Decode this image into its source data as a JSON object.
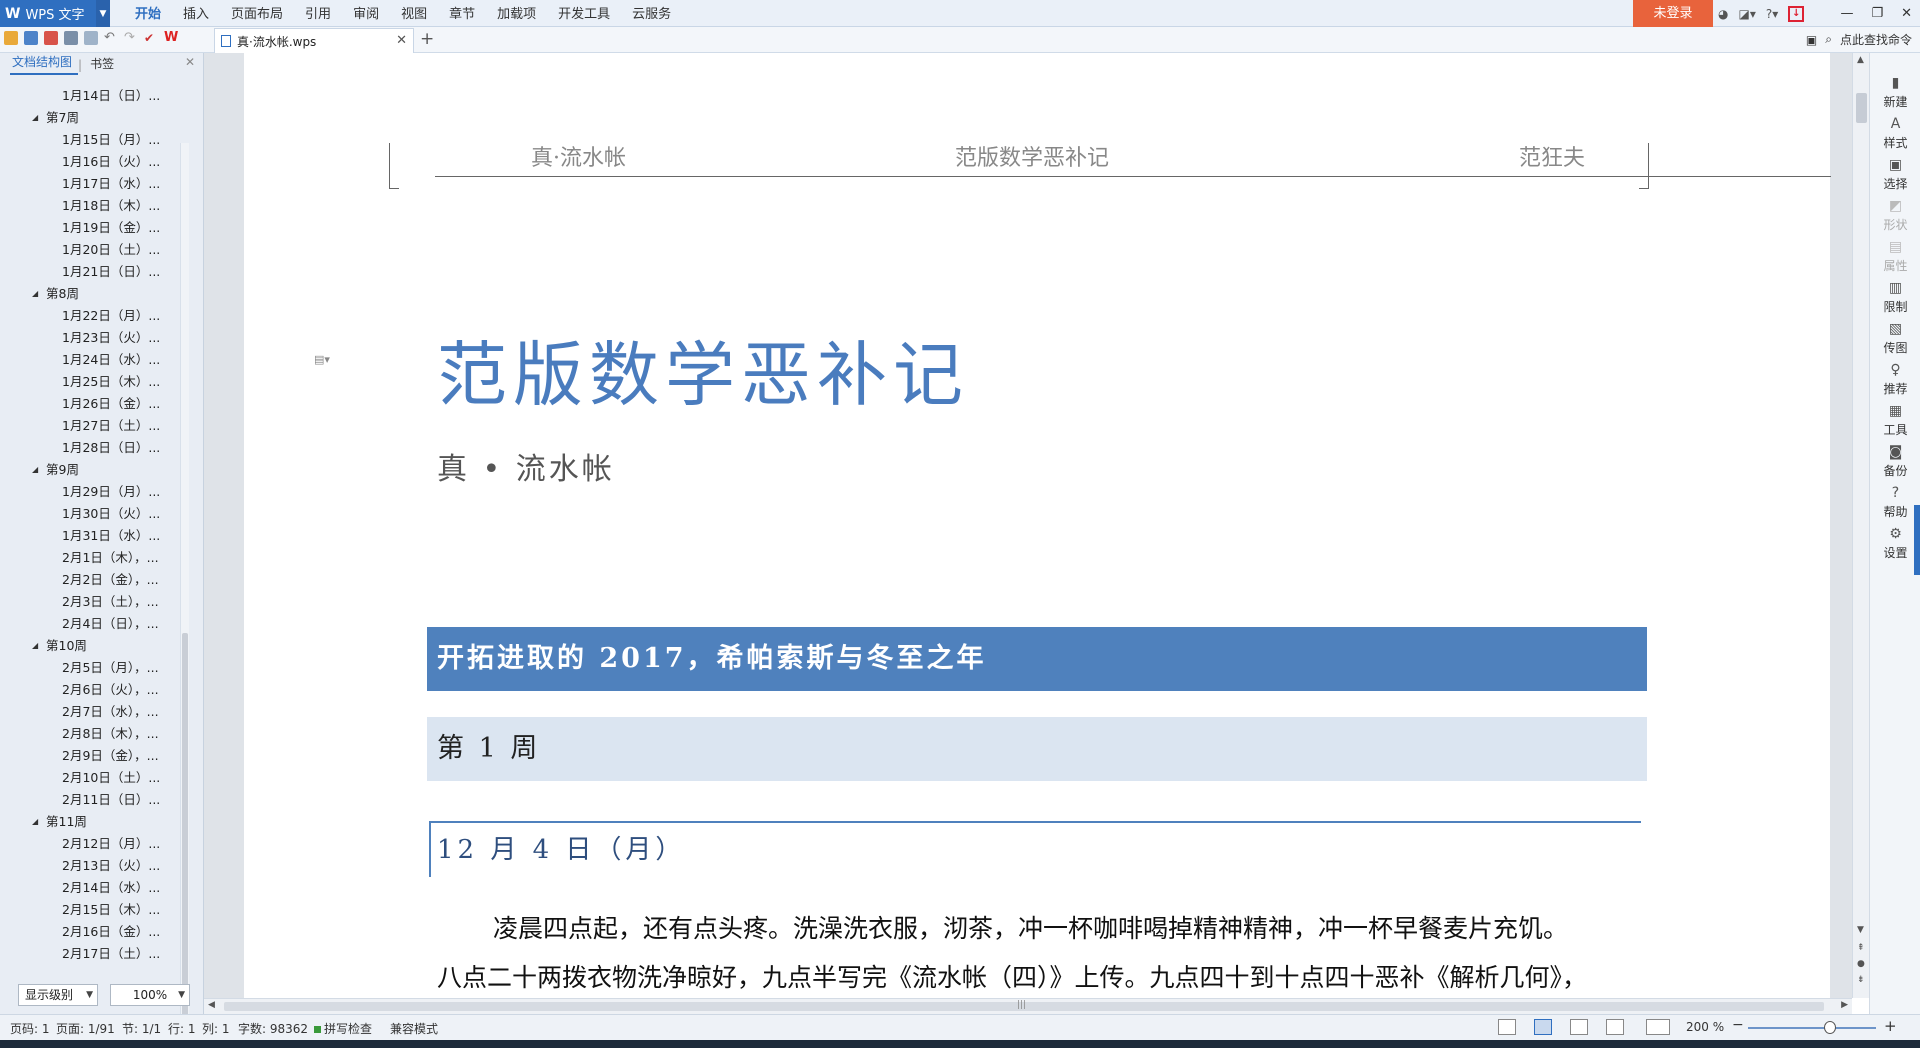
{
  "app": {
    "name": "WPS 文字",
    "logo_glyph": "W"
  },
  "menu": {
    "tabs": [
      "开始",
      "插入",
      "页面布局",
      "引用",
      "审阅",
      "视图",
      "章节",
      "加载项",
      "开发工具",
      "云服务"
    ],
    "active_index": 0,
    "login_label": "未登录",
    "help_glyph": "?"
  },
  "doc_tab": {
    "name": "真·流水帐.wps",
    "new_tab_glyph": "+"
  },
  "command_search": {
    "label": "点此查找命令"
  },
  "left_panel": {
    "tab_doc_map": "文档结构图",
    "tab_bookmarks": "书签",
    "toc": [
      {
        "level": "day",
        "label": "1月14日（日）..."
      },
      {
        "level": "week",
        "label": "第7周"
      },
      {
        "level": "day",
        "label": "1月15日（月）..."
      },
      {
        "level": "day",
        "label": "1月16日（火）..."
      },
      {
        "level": "day",
        "label": "1月17日（水）..."
      },
      {
        "level": "day",
        "label": "1月18日（木）..."
      },
      {
        "level": "day",
        "label": "1月19日（金）..."
      },
      {
        "level": "day",
        "label": "1月20日（土）..."
      },
      {
        "level": "day",
        "label": "1月21日（日）..."
      },
      {
        "level": "week",
        "label": "第8周"
      },
      {
        "level": "day",
        "label": "1月22日（月）..."
      },
      {
        "level": "day",
        "label": "1月23日（火）..."
      },
      {
        "level": "day",
        "label": "1月24日（水）..."
      },
      {
        "level": "day",
        "label": "1月25日（木）..."
      },
      {
        "level": "day",
        "label": "1月26日（金）..."
      },
      {
        "level": "day",
        "label": "1月27日（土）..."
      },
      {
        "level": "day",
        "label": "1月28日（日）..."
      },
      {
        "level": "week",
        "label": "第9周"
      },
      {
        "level": "day",
        "label": "1月29日（月）..."
      },
      {
        "level": "day",
        "label": "1月30日（火）..."
      },
      {
        "level": "day",
        "label": "1月31日（水）..."
      },
      {
        "level": "day",
        "label": "2月1日（木），..."
      },
      {
        "level": "day",
        "label": "2月2日（金），..."
      },
      {
        "level": "day",
        "label": "2月3日（土），..."
      },
      {
        "level": "day",
        "label": "2月4日（日），..."
      },
      {
        "level": "week",
        "label": "第10周"
      },
      {
        "level": "day",
        "label": "2月5日（月），..."
      },
      {
        "level": "day",
        "label": "2月6日（火），..."
      },
      {
        "level": "day",
        "label": "2月7日（水），..."
      },
      {
        "level": "day",
        "label": "2月8日（木），..."
      },
      {
        "level": "day",
        "label": "2月9日（金），..."
      },
      {
        "level": "day",
        "label": "2月10日（土）..."
      },
      {
        "level": "day",
        "label": "2月11日（日）..."
      },
      {
        "level": "week",
        "label": "第11周"
      },
      {
        "level": "day",
        "label": "2月12日（月）..."
      },
      {
        "level": "day",
        "label": "2月13日（火）..."
      },
      {
        "level": "day",
        "label": "2月14日（水）..."
      },
      {
        "level": "day",
        "label": "2月15日（木）..."
      },
      {
        "level": "day",
        "label": "2月16日（金）..."
      },
      {
        "level": "day",
        "label": "2月17日（土）..."
      }
    ],
    "level_select": "显示级别",
    "zoom_select": "100%"
  },
  "document": {
    "header_left": "真·流水帐",
    "header_center": "范版数学恶补记",
    "header_right": "范狂夫",
    "title": "范版数学恶补记",
    "subtitle": "真 • 流水帐",
    "heading1": "开拓进取的 2017，希帕索斯与冬至之年",
    "heading2": "第 1 周",
    "heading3": "12 月 4 日（月）",
    "para1": "凌晨四点起，还有点头疼。洗澡洗衣服，沏茶，冲一杯咖啡喝掉精神精神，冲一杯早餐麦片充饥。",
    "para2": "八点二十两拨衣物洗净晾好，九点半写完《流水帐（四）》上传。九点四十到十点四十恶补《解析几何》，"
  },
  "right_tools": [
    {
      "label": "新建",
      "icon": "new-doc-icon",
      "glyph": "▮",
      "enabled": true
    },
    {
      "label": "样式",
      "icon": "style-icon",
      "glyph": "A",
      "enabled": true
    },
    {
      "label": "选择",
      "icon": "select-icon",
      "glyph": "▣",
      "enabled": true
    },
    {
      "label": "形状",
      "icon": "shape-icon",
      "glyph": "◩",
      "enabled": false
    },
    {
      "label": "属性",
      "icon": "properties-icon",
      "glyph": "▤",
      "enabled": false
    },
    {
      "label": "限制",
      "icon": "restrict-icon",
      "glyph": "▥",
      "enabled": true
    },
    {
      "label": "传图",
      "icon": "upload-image-icon",
      "glyph": "▧",
      "enabled": true
    },
    {
      "label": "推荐",
      "icon": "recommend-icon",
      "glyph": "♀",
      "enabled": true
    },
    {
      "label": "工具",
      "icon": "toolbox-icon",
      "glyph": "▦",
      "enabled": true
    },
    {
      "label": "备份",
      "icon": "backup-icon",
      "glyph": "◙",
      "enabled": true
    },
    {
      "label": "帮助",
      "icon": "help-icon",
      "glyph": "?",
      "enabled": true
    },
    {
      "label": "设置",
      "icon": "settings-icon",
      "glyph": "⚙",
      "enabled": true
    }
  ],
  "status": {
    "page_code": "页码: 1",
    "pages": "页面: 1/91",
    "section": "节: 1/1",
    "row": "行: 1",
    "col": "列: 1",
    "word_count": "字数: 98362",
    "spell_check": "拼写检查",
    "compat_mode": "兼容模式",
    "zoom": "200 %",
    "zoom_minus": "−",
    "zoom_plus": "+"
  },
  "colors": {
    "brand_blue": "#2f6fc0",
    "login_orange": "#e8633c",
    "title_blue": "#4a7cbe",
    "heading1_bg": "#4f81bd",
    "heading2_bg": "#dbe5f1"
  }
}
